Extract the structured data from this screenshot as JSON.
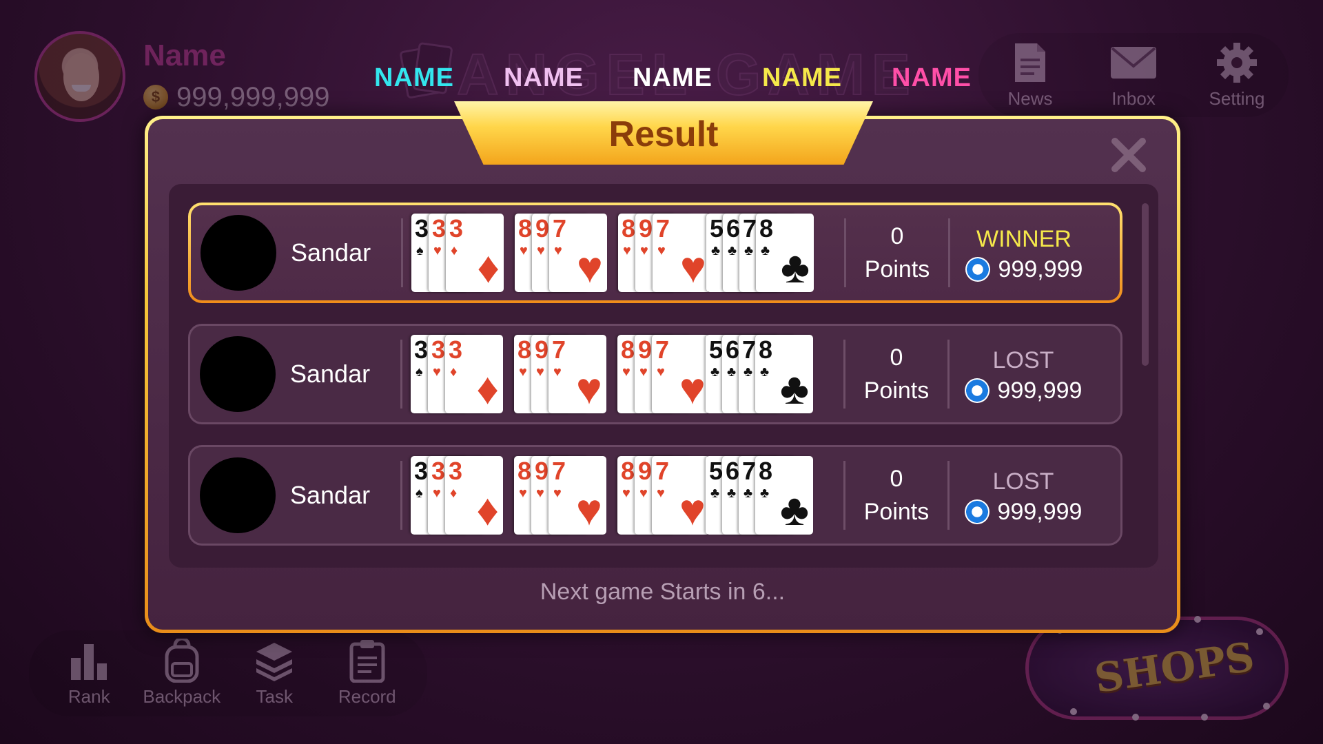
{
  "profile": {
    "name": "Name",
    "coins": "999,999,999"
  },
  "logo": {
    "text": "ANGEL GAME"
  },
  "players": [
    {
      "name": "NAME",
      "color": "#33e6ee"
    },
    {
      "name": "NAME",
      "color": "#f0c0f0"
    },
    {
      "name": "NAME",
      "color": "#ffffff"
    },
    {
      "name": "NAME",
      "color": "#f5e84a"
    },
    {
      "name": "NAME",
      "color": "#ff4fa8"
    }
  ],
  "top_menu": [
    {
      "label": "News",
      "icon": "news-icon"
    },
    {
      "label": "Inbox",
      "icon": "inbox-icon"
    },
    {
      "label": "Setting",
      "icon": "gear-icon"
    }
  ],
  "bottom_menu": [
    {
      "label": "Rank",
      "icon": "bar-chart-icon"
    },
    {
      "label": "Backpack",
      "icon": "backpack-icon"
    },
    {
      "label": "Task",
      "icon": "layers-icon"
    },
    {
      "label": "Record",
      "icon": "clipboard-icon"
    }
  ],
  "shops": {
    "label": "SHOPS"
  },
  "dialog": {
    "title": "Result",
    "footer": "Next game Starts in 6...",
    "rows": [
      {
        "player": "Sandar",
        "points": "0",
        "points_label": "Points",
        "status": "WINNER",
        "status_color": "#f5e84a",
        "prize": "999,999",
        "winner": true,
        "hands": [
          [
            {
              "r": "3",
              "s": "♠"
            },
            {
              "r": "3",
              "s": "♥"
            },
            {
              "r": "3",
              "s": "♦"
            }
          ],
          [
            {
              "r": "8",
              "s": "♥"
            },
            {
              "r": "9",
              "s": "♥"
            },
            {
              "r": "7",
              "s": "♥"
            }
          ],
          [
            {
              "r": "8",
              "s": "♥"
            },
            {
              "r": "9",
              "s": "♥"
            },
            {
              "r": "7",
              "s": "♥"
            }
          ],
          [
            {
              "r": "5",
              "s": "♣"
            },
            {
              "r": "6",
              "s": "♣"
            },
            {
              "r": "7",
              "s": "♣"
            },
            {
              "r": "8",
              "s": "♣"
            }
          ]
        ]
      },
      {
        "player": "Sandar",
        "points": "0",
        "points_label": "Points",
        "status": "LOST",
        "status_color": "#c9aec6",
        "prize": "999,999",
        "winner": false,
        "hands": [
          [
            {
              "r": "3",
              "s": "♠"
            },
            {
              "r": "3",
              "s": "♥"
            },
            {
              "r": "3",
              "s": "♦"
            }
          ],
          [
            {
              "r": "8",
              "s": "♥"
            },
            {
              "r": "9",
              "s": "♥"
            },
            {
              "r": "7",
              "s": "♥"
            }
          ],
          [
            {
              "r": "8",
              "s": "♥"
            },
            {
              "r": "9",
              "s": "♥"
            },
            {
              "r": "7",
              "s": "♥"
            }
          ],
          [
            {
              "r": "5",
              "s": "♣"
            },
            {
              "r": "6",
              "s": "♣"
            },
            {
              "r": "7",
              "s": "♣"
            },
            {
              "r": "8",
              "s": "♣"
            }
          ]
        ]
      },
      {
        "player": "Sandar",
        "points": "0",
        "points_label": "Points",
        "status": "LOST",
        "status_color": "#c9aec6",
        "prize": "999,999",
        "winner": false,
        "hands": [
          [
            {
              "r": "3",
              "s": "♠"
            },
            {
              "r": "3",
              "s": "♥"
            },
            {
              "r": "3",
              "s": "♦"
            }
          ],
          [
            {
              "r": "8",
              "s": "♥"
            },
            {
              "r": "9",
              "s": "♥"
            },
            {
              "r": "7",
              "s": "♥"
            }
          ],
          [
            {
              "r": "8",
              "s": "♥"
            },
            {
              "r": "9",
              "s": "♥"
            },
            {
              "r": "7",
              "s": "♥"
            }
          ],
          [
            {
              "r": "5",
              "s": "♣"
            },
            {
              "r": "6",
              "s": "♣"
            },
            {
              "r": "7",
              "s": "♣"
            },
            {
              "r": "8",
              "s": "♣"
            }
          ]
        ]
      }
    ]
  }
}
